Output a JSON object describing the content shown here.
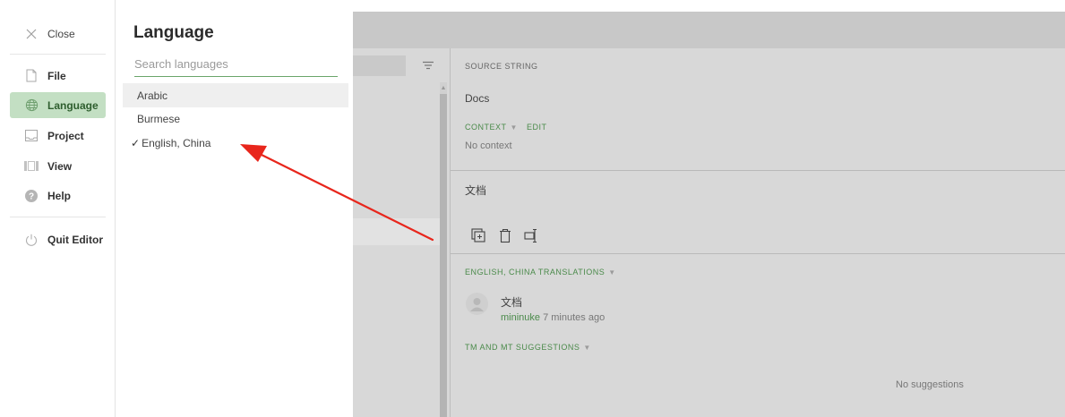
{
  "sidebar": {
    "close_label": "Close",
    "items": [
      {
        "label": "File",
        "icon": "file-icon"
      },
      {
        "label": "Language",
        "icon": "globe-icon",
        "active": true
      },
      {
        "label": "Project",
        "icon": "project-icon"
      },
      {
        "label": "View",
        "icon": "view-icon"
      },
      {
        "label": "Help",
        "icon": "help-icon"
      }
    ],
    "quit_label": "Quit Editor"
  },
  "language_panel": {
    "title": "Language",
    "search_placeholder": "Search languages",
    "languages": [
      {
        "label": "Arabic",
        "selected": false
      },
      {
        "label": "Burmese",
        "selected": false
      },
      {
        "label": "English, China",
        "selected": true
      }
    ],
    "check_mark": "✓"
  },
  "editor": {
    "source_label": "SOURCE STRING",
    "source_text": "Docs",
    "context_label": "CONTEXT",
    "caret": "▼",
    "edit_label": "EDIT",
    "no_context": "No context",
    "translation_text": "文档",
    "translations_heading": "ENGLISH, CHINA TRANSLATIONS",
    "entry": {
      "text": "文档",
      "user": "mininuke",
      "time": "7 minutes ago"
    },
    "suggestions_heading": "TM AND MT SUGGESTIONS",
    "no_suggestions": "No suggestions"
  },
  "colors": {
    "accent_green": "#4a8a4a",
    "active_bg": "#c3dfc3",
    "annotation_red": "#e8261c"
  }
}
